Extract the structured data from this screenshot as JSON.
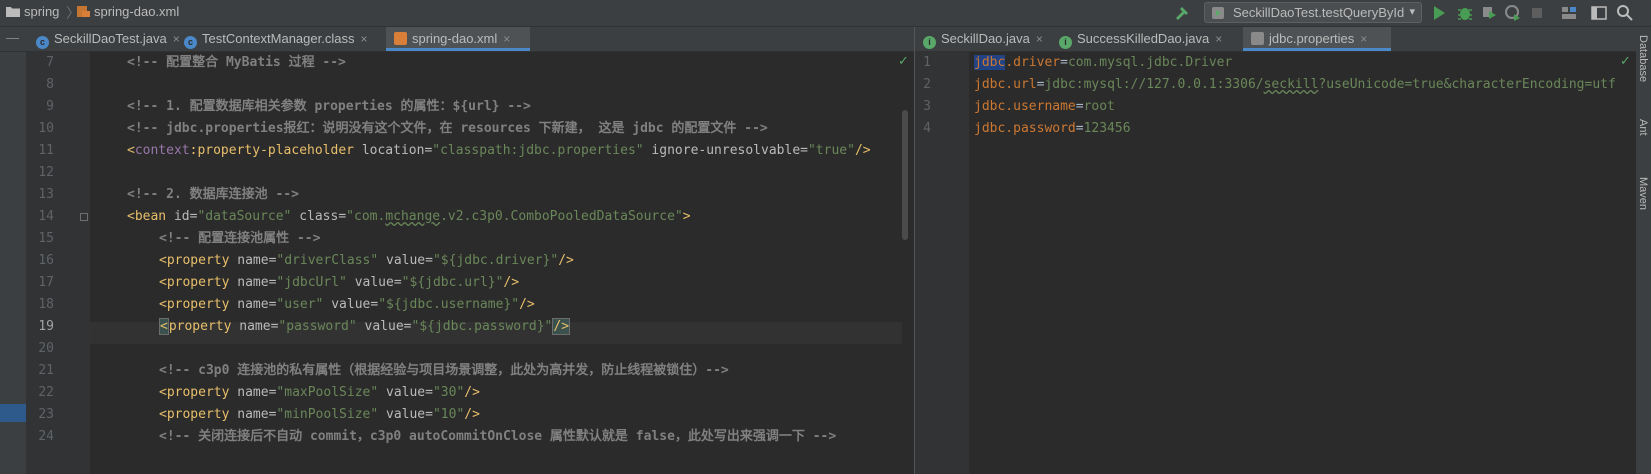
{
  "breadcrumb": {
    "project": "spring",
    "file": "spring-dao.xml"
  },
  "run_config": {
    "label": "SeckillDaoTest.testQueryById"
  },
  "colors": {
    "accent": "#4a88c7",
    "run_green": "#499c54",
    "selection": "#214283"
  },
  "left_tabs": [
    {
      "label": "SeckillDaoTest.java",
      "icon": "class-icon"
    },
    {
      "label": "TestContextManager.class",
      "icon": "class-icon"
    },
    {
      "label": "spring-dao.xml",
      "icon": "xml-icon",
      "active": true
    }
  ],
  "right_tabs": [
    {
      "label": "SeckillDao.java",
      "icon": "interface-icon"
    },
    {
      "label": "SuccessKilledDao.java",
      "icon": "interface-icon"
    },
    {
      "label": "jdbc.properties",
      "icon": "properties-icon",
      "active": true
    }
  ],
  "left_editor": {
    "line_numbers": [
      "7",
      "8",
      "9",
      "10",
      "11",
      "12",
      "13",
      "14",
      "15",
      "16",
      "17",
      "18",
      "19",
      "20",
      "21",
      "22",
      "23",
      "24"
    ],
    "current_line": "19",
    "lines": {
      "l7_comment": "<!-- 配置整合 MyBatis 过程 -->",
      "l9_comment": "<!-- 1. 配置数据库相关参数 properties 的属性：${url} -->",
      "l10_comment": "<!-- jdbc.properties报红：说明没有这个文件，在 resources 下新建， 这是 jdbc 的配置文件 -->",
      "l11_lt": "<",
      "l11_ns": "context",
      "l11_tag": ":property-placeholder",
      "l11_attr1": " location=",
      "l11_val1": "\"classpath:jdbc.properties\"",
      "l11_attr2": " ignore-unresolvable=",
      "l11_val2": "\"true\"",
      "l11_end": "/>",
      "l13_comment": "<!-- 2. 数据库连接池 -->",
      "l14_tag": "<bean",
      "l14_attr1": " id=",
      "l14_val1": "\"dataSource\"",
      "l14_attr2": " class=",
      "l14_val2a": "\"com.",
      "l14_val2b": "mchange",
      "l14_val2c": ".v2.c3p0.ComboPooledDataSource\"",
      "l14_end": ">",
      "l15_comment": "<!-- 配置连接池属性 -->",
      "prop_tag": "<property",
      "name_attr": " name=",
      "value_attr": " value=",
      "prop_end": "/>",
      "l16_name": "\"driverClass\"",
      "l16_value": "\"${jdbc.driver}\"",
      "l17_name": "\"jdbcUrl\"",
      "l17_value": "\"${jdbc.url}\"",
      "l18_name": "\"user\"",
      "l18_value": "\"${jdbc.username}\"",
      "l19_lt": "<",
      "l19_tag": "property",
      "l19_name": "\"password\"",
      "l19_value": "\"${jdbc.password}\"",
      "l21_comment": "<!-- c3p0 连接池的私有属性（根据经验与项目场景调整，此处为高并发，防止线程被锁住）-->",
      "l22_name": "\"maxPoolSize\"",
      "l22_value": "\"30\"",
      "l23_name": "\"minPoolSize\"",
      "l23_value": "\"10\"",
      "l24_comment": "<!-- 关闭连接后不自动 commit，c3p0 autoCommitOnClose 属性默认就是 false，此处写出来强调一下 -->"
    }
  },
  "right_editor": {
    "line_numbers": [
      "1",
      "2",
      "3",
      "4"
    ],
    "lines": {
      "l1_key_sel": "jdbc",
      "l1_key_rest": ".driver",
      "l1_eq": "=",
      "l1_val": "com.mysql.jdbc.Driver",
      "l2_key": "jdbc.url",
      "l2_eq": "=",
      "l2_val_a": "jdbc:mysql://127.0.0.1:3306/",
      "l2_val_b": "seckill",
      "l2_val_c": "?useUnicode=true&characterEncoding=utf",
      "l3_key": "jdbc.username",
      "l3_eq": "=",
      "l3_val": "root",
      "l4_key": "jdbc.password",
      "l4_eq": "=",
      "l4_val": "123456"
    }
  },
  "side_tools": {
    "database": "Database",
    "ant": "Ant",
    "maven": "Maven"
  }
}
